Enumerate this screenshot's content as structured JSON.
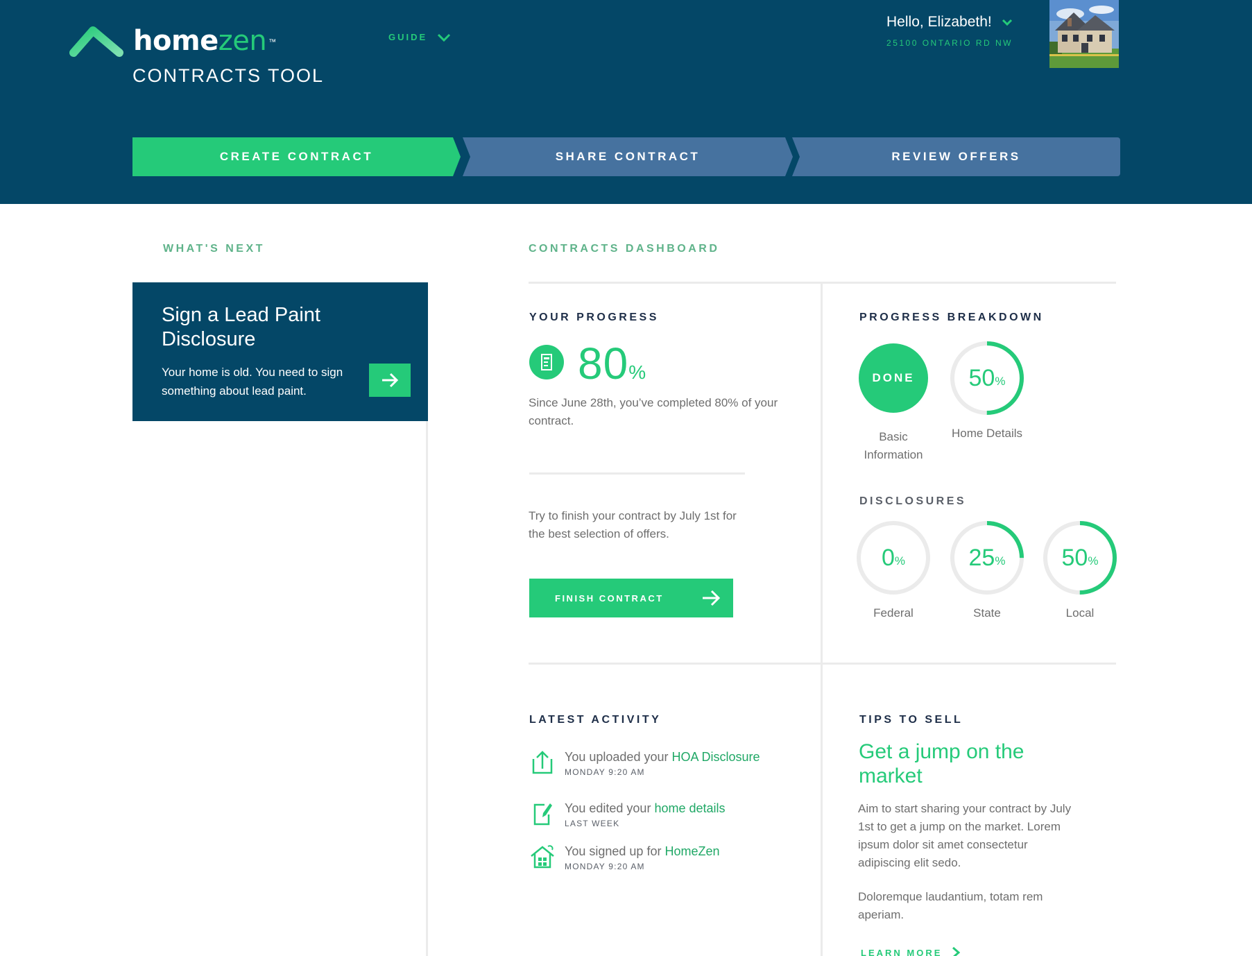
{
  "app": {
    "logo_home": "home",
    "logo_zen": "zen",
    "logo_tm": "™",
    "tool_title": "CONTRACTS TOOL",
    "guide_label": "GUIDE"
  },
  "user": {
    "greeting": "Hello, Elizabeth!",
    "address": "25100 ONTARIO RD NW"
  },
  "steps": [
    {
      "label": "CREATE CONTRACT",
      "active": true
    },
    {
      "label": "SHARE CONTRACT",
      "active": false
    },
    {
      "label": "REVIEW OFFERS",
      "active": false
    }
  ],
  "whats_next": {
    "heading": "WHAT'S NEXT",
    "card_title": "Sign a Lead Paint Disclosure",
    "card_desc": "Your home is old. You need to sign something about lead paint."
  },
  "dashboard": {
    "heading": "CONTRACTS DASHBOARD",
    "progress": {
      "heading": "YOUR PROGRESS",
      "value": "80",
      "unit": "%",
      "summary": "Since June 28th, you’ve completed 80% of your contract.",
      "tip": "Try to finish your contract by July 1st for the best selection of offers.",
      "button": "FINISH CONTRACT"
    },
    "breakdown": {
      "heading": "PROGRESS BREAKDOWN",
      "items": [
        {
          "label": "Basic Information",
          "done_label": "DONE",
          "fraction": 1.0
        },
        {
          "label": "Home Details",
          "value": "50",
          "unit": "%",
          "fraction": 0.5
        }
      ]
    },
    "disclosures": {
      "heading": "DISCLOSURES",
      "items": [
        {
          "label": "Federal",
          "value": "0",
          "unit": "%",
          "fraction": 0.0
        },
        {
          "label": "State",
          "value": "25",
          "unit": "%",
          "fraction": 0.25
        },
        {
          "label": "Local",
          "value": "50",
          "unit": "%",
          "fraction": 0.5
        }
      ]
    },
    "activity": {
      "heading": "LATEST ACTIVITY",
      "items": [
        {
          "text": "You uploaded your ",
          "link": "HOA Disclosure",
          "time": "MONDAY 9:20 AM",
          "icon": "upload-icon"
        },
        {
          "text": "You edited your ",
          "link": "home details",
          "time": "LAST WEEK",
          "icon": "edit-document-icon"
        },
        {
          "text": "You signed up for ",
          "link": "HomeZen",
          "time": "MONDAY 9:20 AM",
          "icon": "house-icon"
        }
      ]
    },
    "tips": {
      "heading": "TIPS TO SELL",
      "title": "Get a jump on the market",
      "para1": "Aim to start sharing your contract by July 1st to get a jump on the market. Lorem ipsum dolor sit amet consectetur adipiscing elit sedo.",
      "para2": "Doloremque laudantium, totam rem aperiam.",
      "link": "LEARN MORE"
    }
  },
  "colors": {
    "header_bg": "#044767",
    "accent": "#25ca79",
    "step_inactive": "#46729f",
    "ring_track": "#ebebeb"
  }
}
